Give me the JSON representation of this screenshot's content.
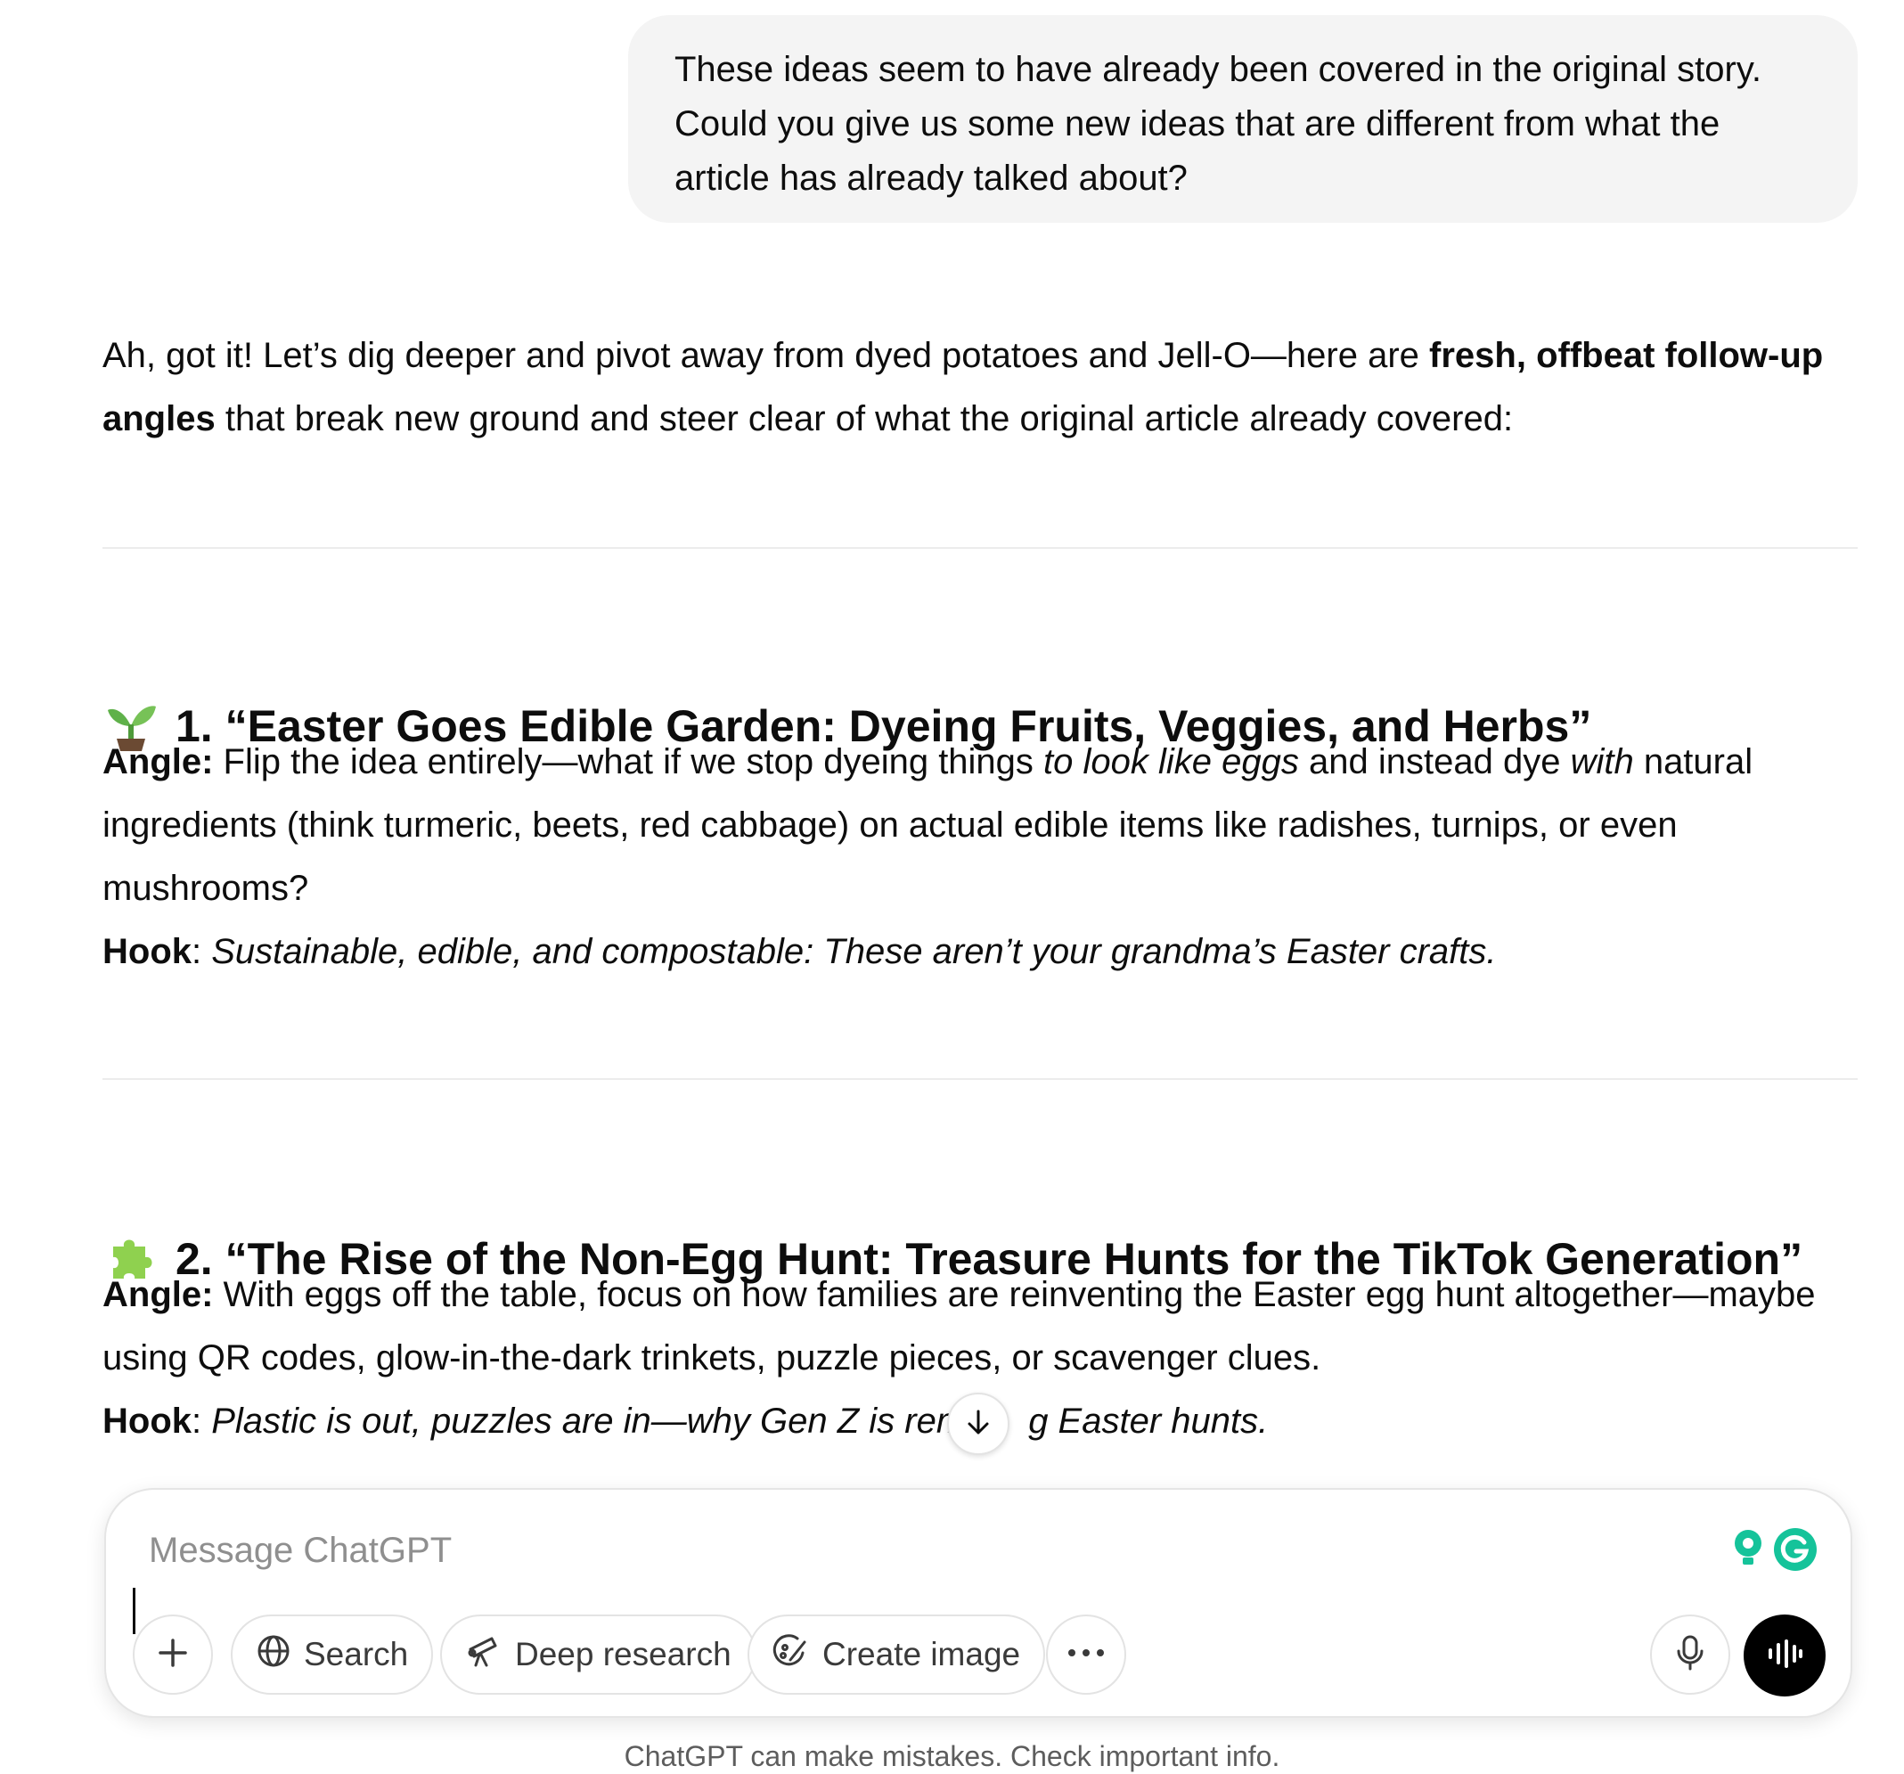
{
  "user_message": {
    "line1": "These ideas seem to have already been covered in the original story.",
    "line2": "Could you give us some new ideas that are different from what the",
    "line3": "article has already talked about?"
  },
  "assistant": {
    "intro_a": "Ah, got it! Let’s dig deeper and pivot away from dyed potatoes and Jell-O—here are ",
    "intro_bold": "fresh, offbeat follow-up angles",
    "intro_b": " that break new ground and steer clear of what the original article already covered:",
    "sections": [
      {
        "emoji": "seedling-icon",
        "title": "1. “Easter Goes Edible Garden: Dyeing Fruits, Veggies, and Herbs”",
        "angle_label": "Angle:",
        "angle_a": " Flip the idea entirely—what if we stop dyeing things ",
        "angle_i1": "to look like eggs",
        "angle_b": " and instead dye ",
        "angle_i2": "with",
        "angle_c": " natural ingredients (think turmeric, beets, red cabbage) on actual edible items like radishes, turnips, or even mushrooms?",
        "hook_label": "Hook",
        "hook_colon": ": ",
        "hook_text": "Sustainable, edible, and compostable: These aren’t your grandma’s Easter crafts."
      },
      {
        "emoji": "puzzle-piece-icon",
        "title": "2. “The Rise of the Non-Egg Hunt: Treasure Hunts for the TikTok Generation”",
        "angle_label": "Angle:",
        "angle_a": " With eggs off the table, focus on how families are reinventing the Easter egg hunt altogether—maybe using QR codes, glow-in-the-dark trinkets, puzzle pieces, or scavenger clues.",
        "hook_label": "Hook",
        "hook_colon": ": ",
        "hook_text": "Plastic is out, puzzles are in—why Gen Z is rem",
        "hook_text_tail": "g Easter hunts."
      }
    ]
  },
  "composer": {
    "placeholder": "Message ChatGPT",
    "buttons": {
      "add": "plus-icon",
      "search": "Search",
      "deep_research": "Deep research",
      "create_image": "Create image",
      "more": "more-icon",
      "mic": "microphone-icon",
      "voice": "voice-mode-icon"
    }
  },
  "disclaimer": "ChatGPT can make mistakes. Check important info.",
  "colors": {
    "user_bubble": "#f4f4f4",
    "text": "#0d0d0d",
    "grammarly_green": "#15c39a"
  }
}
